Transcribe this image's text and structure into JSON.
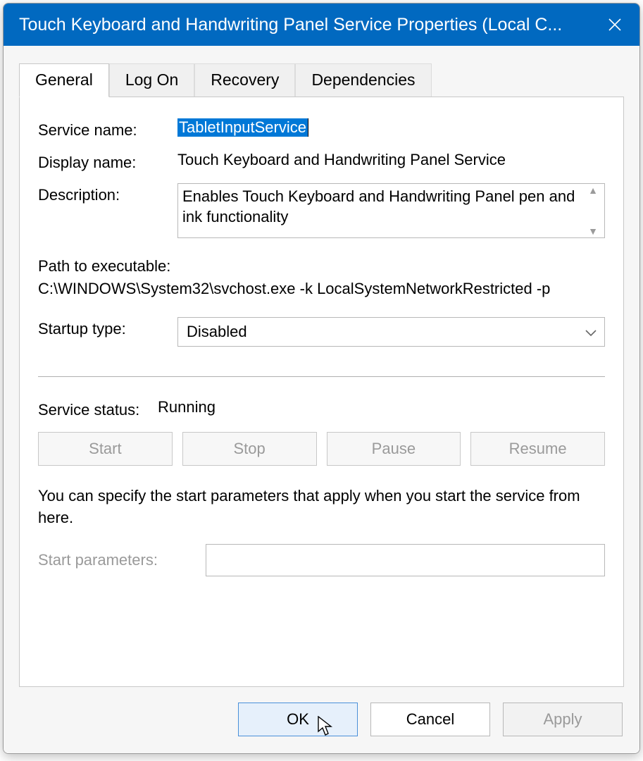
{
  "titlebar": {
    "title": "Touch Keyboard and Handwriting Panel Service Properties (Local C..."
  },
  "tabs": {
    "items": [
      {
        "label": "General",
        "active": true
      },
      {
        "label": "Log On",
        "active": false
      },
      {
        "label": "Recovery",
        "active": false
      },
      {
        "label": "Dependencies",
        "active": false
      }
    ]
  },
  "labels": {
    "service_name": "Service name:",
    "display_name": "Display name:",
    "description": "Description:",
    "path_to_exe": "Path to executable:",
    "startup_type": "Startup type:",
    "service_status": "Service status:",
    "start_parameters": "Start parameters:"
  },
  "values": {
    "service_name": "TabletInputService",
    "display_name": "Touch Keyboard and Handwriting Panel Service",
    "description": "Enables Touch Keyboard and Handwriting Panel pen and ink functionality",
    "exe_path": "C:\\WINDOWS\\System32\\svchost.exe -k LocalSystemNetworkRestricted -p",
    "startup_type": "Disabled",
    "service_status": "Running",
    "start_parameters": ""
  },
  "control_buttons": {
    "start": "Start",
    "stop": "Stop",
    "pause": "Pause",
    "resume": "Resume"
  },
  "hint": "You can specify the start parameters that apply when you start the service from here.",
  "footer": {
    "ok": "OK",
    "cancel": "Cancel",
    "apply": "Apply"
  }
}
